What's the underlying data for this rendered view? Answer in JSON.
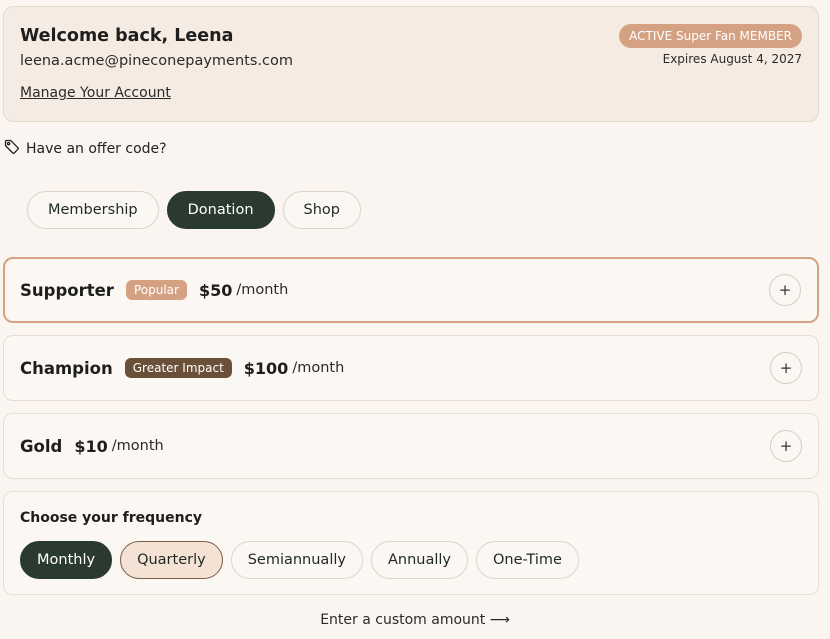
{
  "account": {
    "welcome": "Welcome back, Leena",
    "email": "leena.acme@pineconepayments.com",
    "manage_link": "Manage Your Account",
    "badge": "ACTIVE Super Fan MEMBER",
    "expires": "Expires August 4, 2027"
  },
  "offer": {
    "label": "Have an offer code?",
    "icon": "tag-icon"
  },
  "tabs": [
    {
      "label": "Membership",
      "active": false
    },
    {
      "label": "Donation",
      "active": true
    },
    {
      "label": "Shop",
      "active": false
    }
  ],
  "tiers": [
    {
      "name": "Supporter",
      "badge": "Popular",
      "price": "$50",
      "period": "/month",
      "selected": true
    },
    {
      "name": "Champion",
      "badge": "Greater Impact",
      "price": "$100",
      "period": "/month",
      "selected": false
    },
    {
      "name": "Gold",
      "badge": "",
      "price": "$10",
      "period": "/month",
      "selected": false
    }
  ],
  "expand_symbol": "+",
  "frequency": {
    "title": "Choose your frequency",
    "options": [
      "Monthly",
      "Quarterly",
      "Semiannually",
      "Annually",
      "One-Time"
    ],
    "selected": "Monthly",
    "hovered": "Quarterly"
  },
  "custom_amount": "Enter a custom amount ⟶",
  "colors": {
    "accent": "#d4a283",
    "dark": "#2b3a2f",
    "impact": "#6a5038",
    "background": "#faf5f0"
  }
}
